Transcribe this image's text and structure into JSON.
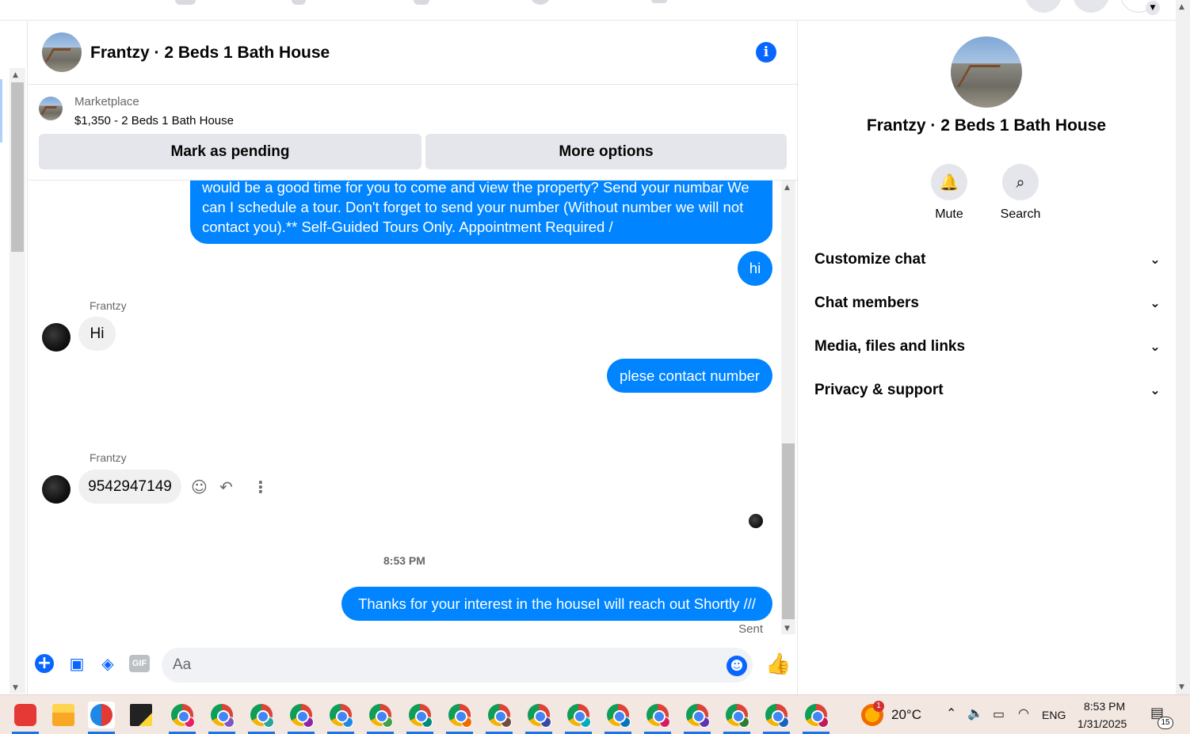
{
  "chat_header": {
    "title": "Frantzy · 2 Beds 1 Bath House"
  },
  "marketplace": {
    "label": "Marketplace",
    "listing": "$1,350 - 2 Beds 1 Bath House",
    "pending_button": "Mark as pending",
    "more_button": "More options"
  },
  "messages": {
    "long_outgoing": "would be a good time for you to come and view the property? Send your numbar We can I schedule a tour.  Don't forget to send your number (Without number we will not contact you).** Self-Guided Tours Only. Appointment Required /",
    "out_hi": "hi",
    "sender1": "Frantzy",
    "in_hi": "Hi",
    "out_plese": "plese contact number",
    "sender2": "Frantzy",
    "in_number": "9542947149",
    "timestamp": "8:53 PM",
    "out_thanks": "Thanks for your interest in the houseI will reach out Shortly ///",
    "status": "Sent"
  },
  "composer": {
    "placeholder": "Aa",
    "gif_label": "GIF"
  },
  "info_panel": {
    "title": "Frantzy · 2 Beds 1 Bath House",
    "mute_label": "Mute",
    "search_label": "Search",
    "sections": [
      {
        "label": "Customize chat"
      },
      {
        "label": "Chat members"
      },
      {
        "label": "Media, files and links"
      },
      {
        "label": "Privacy & support"
      }
    ]
  },
  "taskbar": {
    "weather_temp": "20°C",
    "weather_badge": "1",
    "language": "ENG",
    "time": "8:53 PM",
    "date": "1/31/2025",
    "notification_count": "15",
    "chrome_profile_colors": [
      "#e91e63",
      "#7e57c2",
      "#26a69a",
      "#8e24aa",
      "#1e88e5",
      "#43a047",
      "#00897b",
      "#ef6c00",
      "#6d4c41",
      "#3949ab",
      "#00acc1",
      "#0277bd",
      "#d81b60",
      "#5e35b1",
      "#2e7d32",
      "#1565c0",
      "#c2185b"
    ]
  },
  "colors": {
    "accent": "#0866ff",
    "outgoing_bubble": "#0084ff",
    "incoming_bubble": "#f0f0f0",
    "button_gray": "#e4e6eb"
  }
}
